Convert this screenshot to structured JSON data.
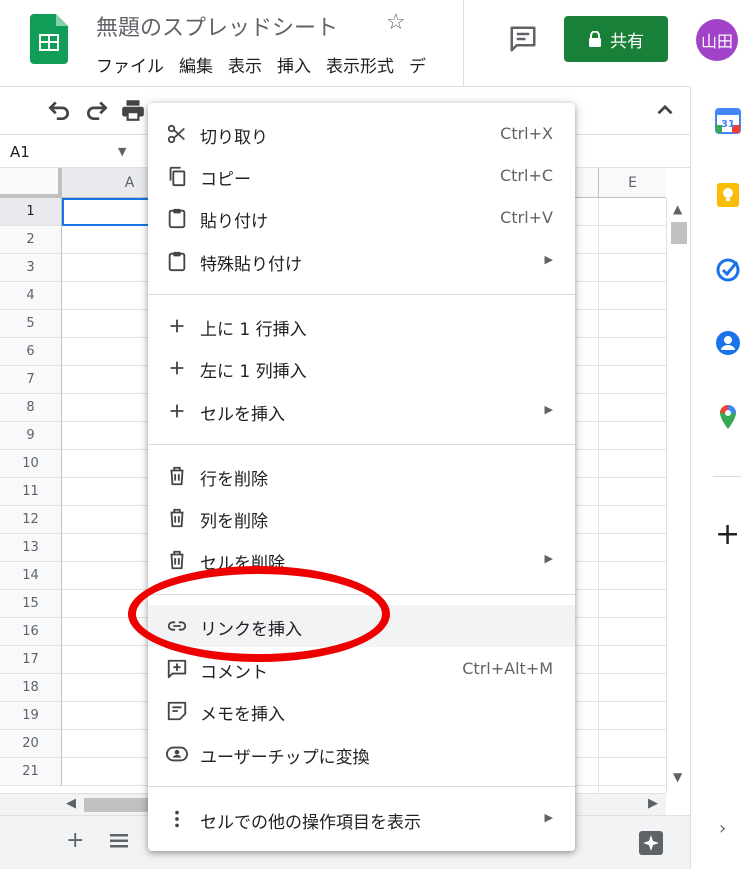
{
  "header": {
    "doc_title": "無題のスプレッドシート",
    "menu": [
      "ファイル",
      "編集",
      "表示",
      "挿入",
      "表示形式",
      "デ"
    ],
    "share_label": "共有",
    "avatar_text": "山田",
    "share_color": "#188038",
    "avatar_color": "#a142c9"
  },
  "formula_bar": {
    "cell_ref": "A1"
  },
  "grid": {
    "columns": [
      "A",
      "E"
    ],
    "rows": [
      "1",
      "2",
      "3",
      "4",
      "5",
      "6",
      "7",
      "8",
      "9",
      "10",
      "11",
      "12",
      "13",
      "14",
      "15",
      "16",
      "17",
      "18",
      "19",
      "20",
      "21"
    ]
  },
  "context_menu": {
    "items": [
      {
        "label": "切り取り",
        "shortcut": "Ctrl+X",
        "icon": "scissors-icon"
      },
      {
        "label": "コピー",
        "shortcut": "Ctrl+C",
        "icon": "copy-icon"
      },
      {
        "label": "貼り付け",
        "shortcut": "Ctrl+V",
        "icon": "clipboard-icon"
      },
      {
        "label": "特殊貼り付け",
        "submenu": true,
        "icon": "clipboard-icon"
      },
      {
        "label": "上に 1 行挿入",
        "icon": "plus-icon"
      },
      {
        "label": "左に 1 列挿入",
        "icon": "plus-icon"
      },
      {
        "label": "セルを挿入",
        "submenu": true,
        "icon": "plus-icon"
      },
      {
        "label": "行を削除",
        "icon": "trash-icon"
      },
      {
        "label": "列を削除",
        "icon": "trash-icon"
      },
      {
        "label": "セルを削除",
        "submenu": true,
        "icon": "trash-icon"
      },
      {
        "label": "リンクを挿入",
        "icon": "link-icon",
        "highlighted": true
      },
      {
        "label": "コメント",
        "shortcut": "Ctrl+Alt+M",
        "icon": "comment-add-icon"
      },
      {
        "label": "メモを挿入",
        "icon": "note-icon"
      },
      {
        "label": "ユーザーチップに変換",
        "icon": "person-chip-icon"
      },
      {
        "label": "セルでの他の操作項目を表示",
        "submenu": true,
        "icon": "more-vert-icon"
      }
    ]
  },
  "annotation": {
    "color": "#ee0000",
    "target": "リンクを挿入"
  }
}
